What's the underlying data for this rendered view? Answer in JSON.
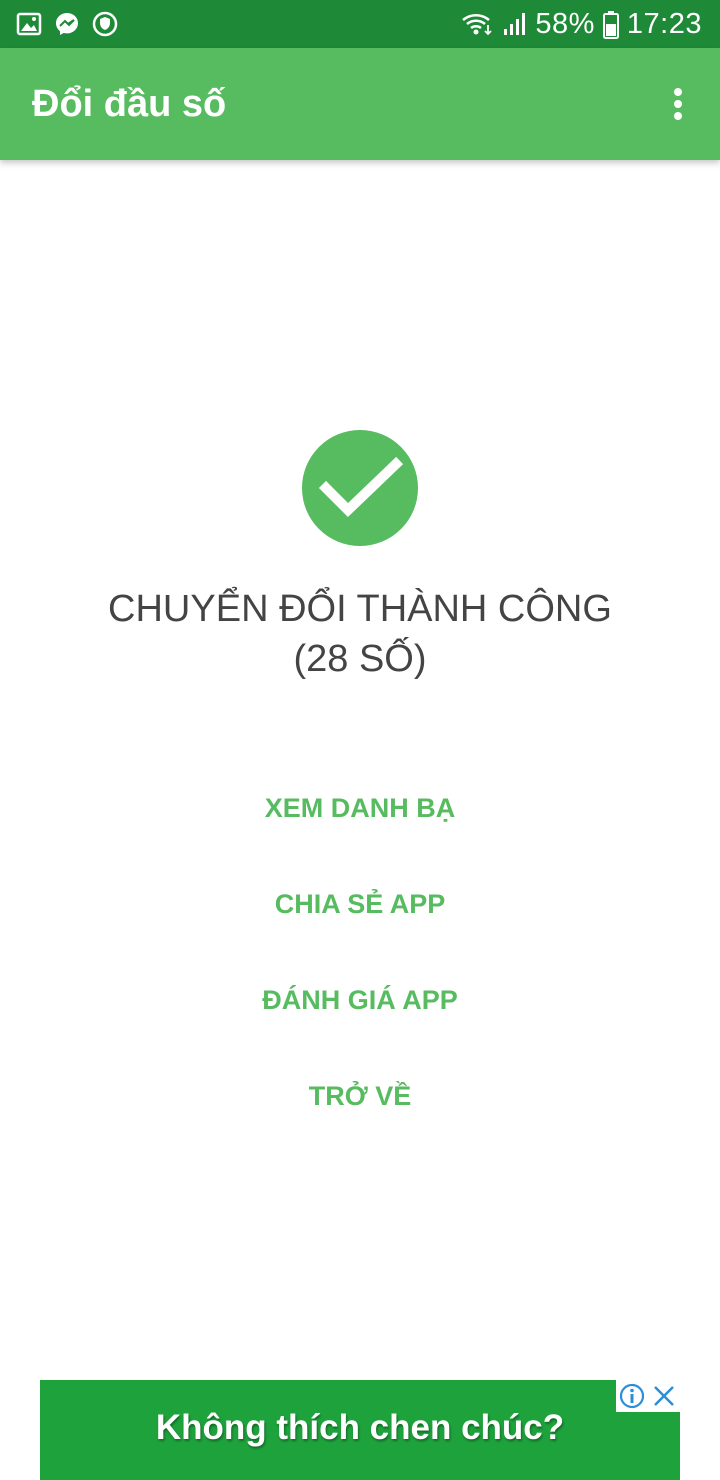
{
  "status_bar": {
    "battery": "58%",
    "time": "17:23",
    "icons": [
      "gallery-icon",
      "messenger-icon",
      "shield-icon",
      "wifi-icon",
      "signal-icon",
      "battery-icon"
    ]
  },
  "app_bar": {
    "title": "Đổi đầu số",
    "menu_icon": "more-vertical-icon"
  },
  "result": {
    "icon": "check-circle-icon",
    "line1": "CHUYỂN ĐỔI THÀNH CÔNG",
    "line2": "(28 SỐ)"
  },
  "actions": {
    "view_contacts": "XEM DANH BẠ",
    "share_app": "CHIA SẺ APP",
    "rate_app": "ĐÁNH GIÁ APP",
    "back": "TRỞ VỀ"
  },
  "ad": {
    "text": "Không thích chen chúc?",
    "info_icon": "info-icon",
    "close_icon": "close-icon"
  },
  "colors": {
    "status_bar": "#1e8a38",
    "primary": "#57bb60",
    "ad_background": "#1ea23c",
    "text_dark": "#444444",
    "ad_controls": "#2a8fd8"
  }
}
